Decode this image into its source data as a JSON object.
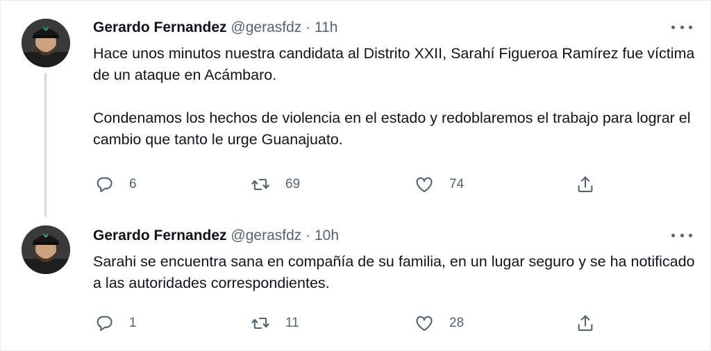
{
  "tweets": [
    {
      "author_name": "Gerardo Fernandez",
      "handle": "@gerasfdz",
      "separator": "·",
      "time": "11h",
      "text": "Hace unos minutos nuestra candidata al Distrito XXII, Sarahí Figueroa Ramírez fue víctima de un ataque en Acámbaro.\n\nCondenamos los hechos de violencia en el estado y redoblaremos el trabajo para lograr el cambio que tanto le urge  Guanajuato.",
      "replies": "6",
      "retweets": "69",
      "likes": "74"
    },
    {
      "author_name": "Gerardo Fernandez",
      "handle": "@gerasfdz",
      "separator": "·",
      "time": "10h",
      "text": "Sarahi se encuentra sana en compañía de su familia, en un lugar seguro y se ha notificado a las autoridades correspondientes.",
      "replies": "1",
      "retweets": "11",
      "likes": "28"
    }
  ],
  "icons": {
    "reply": "speech-bubble",
    "retweet": "retweet-arrows",
    "like": "heart",
    "share": "upload-arrow",
    "more": "three-dots"
  },
  "colors": {
    "text": "#0f1419",
    "secondary": "#536471",
    "thread_line": "#cfd9de"
  }
}
